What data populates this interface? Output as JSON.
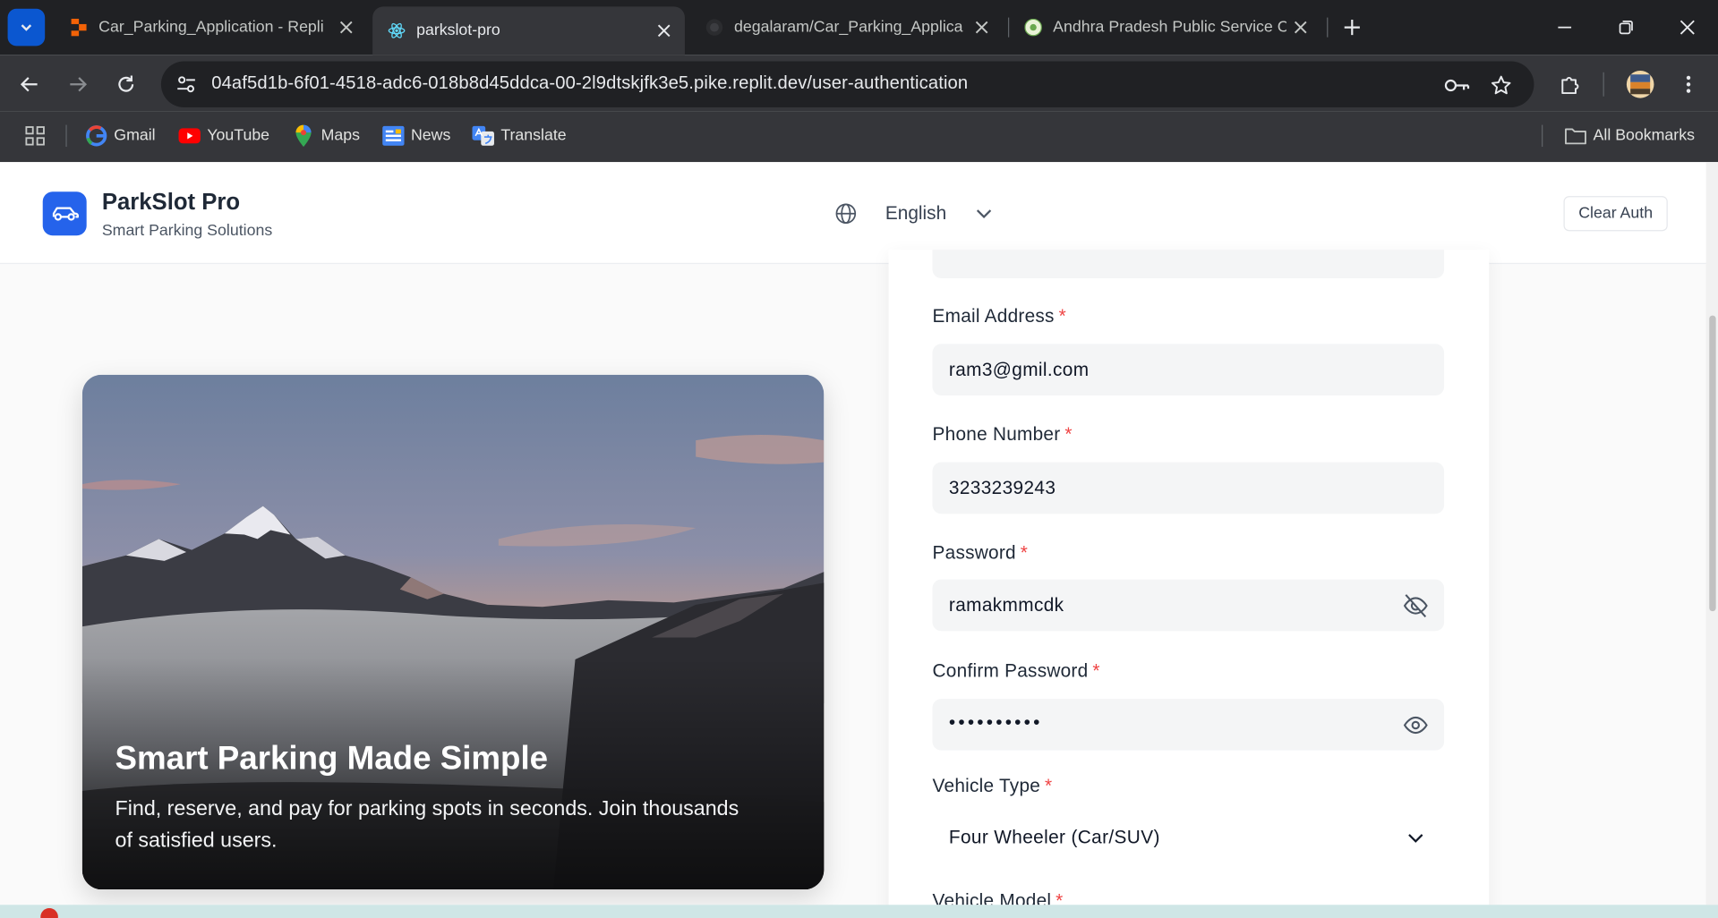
{
  "browser": {
    "tabs": [
      {
        "title": "Car_Parking_Application - Repli",
        "active": false
      },
      {
        "title": "parkslot-pro",
        "active": true
      },
      {
        "title": "degalaram/Car_Parking_Applica",
        "active": false
      },
      {
        "title": "Andhra Pradesh Public Service C",
        "active": false
      }
    ],
    "url": "04af5d1b-6f01-4518-adc6-018b8d45ddca-00-2l9dtskjfk3e5.pike.replit.dev/user-authentication",
    "bookmarks": [
      {
        "label": "Gmail",
        "icon": "gmail-icon"
      },
      {
        "label": "YouTube",
        "icon": "youtube-icon"
      },
      {
        "label": "Maps",
        "icon": "maps-icon"
      },
      {
        "label": "News",
        "icon": "news-icon"
      },
      {
        "label": "Translate",
        "icon": "translate-icon"
      }
    ],
    "all_bookmarks": "All Bookmarks"
  },
  "app": {
    "name": "ParkSlot Pro",
    "tagline": "Smart Parking Solutions",
    "language": "English",
    "clear_auth": "Clear Auth",
    "brand_color": "#2563eb"
  },
  "hero": {
    "title": "Smart Parking Made Simple",
    "text": "Find, reserve, and pay for parking spots in seconds. Join thousands of satisfied users."
  },
  "form": {
    "required_mark": "*",
    "email": {
      "label": "Email Address",
      "value": "ram3@gmil.com"
    },
    "phone": {
      "label": "Phone Number",
      "value": "3233239243"
    },
    "password": {
      "label": "Password",
      "value": "ramakmmcdk"
    },
    "confirm_password": {
      "label": "Confirm Password",
      "value": "••••••••••"
    },
    "vehicle_type": {
      "label": "Vehicle Type",
      "value": "Four Wheeler (Car/SUV)"
    },
    "vehicle_model": {
      "label": "Vehicle Model"
    }
  }
}
